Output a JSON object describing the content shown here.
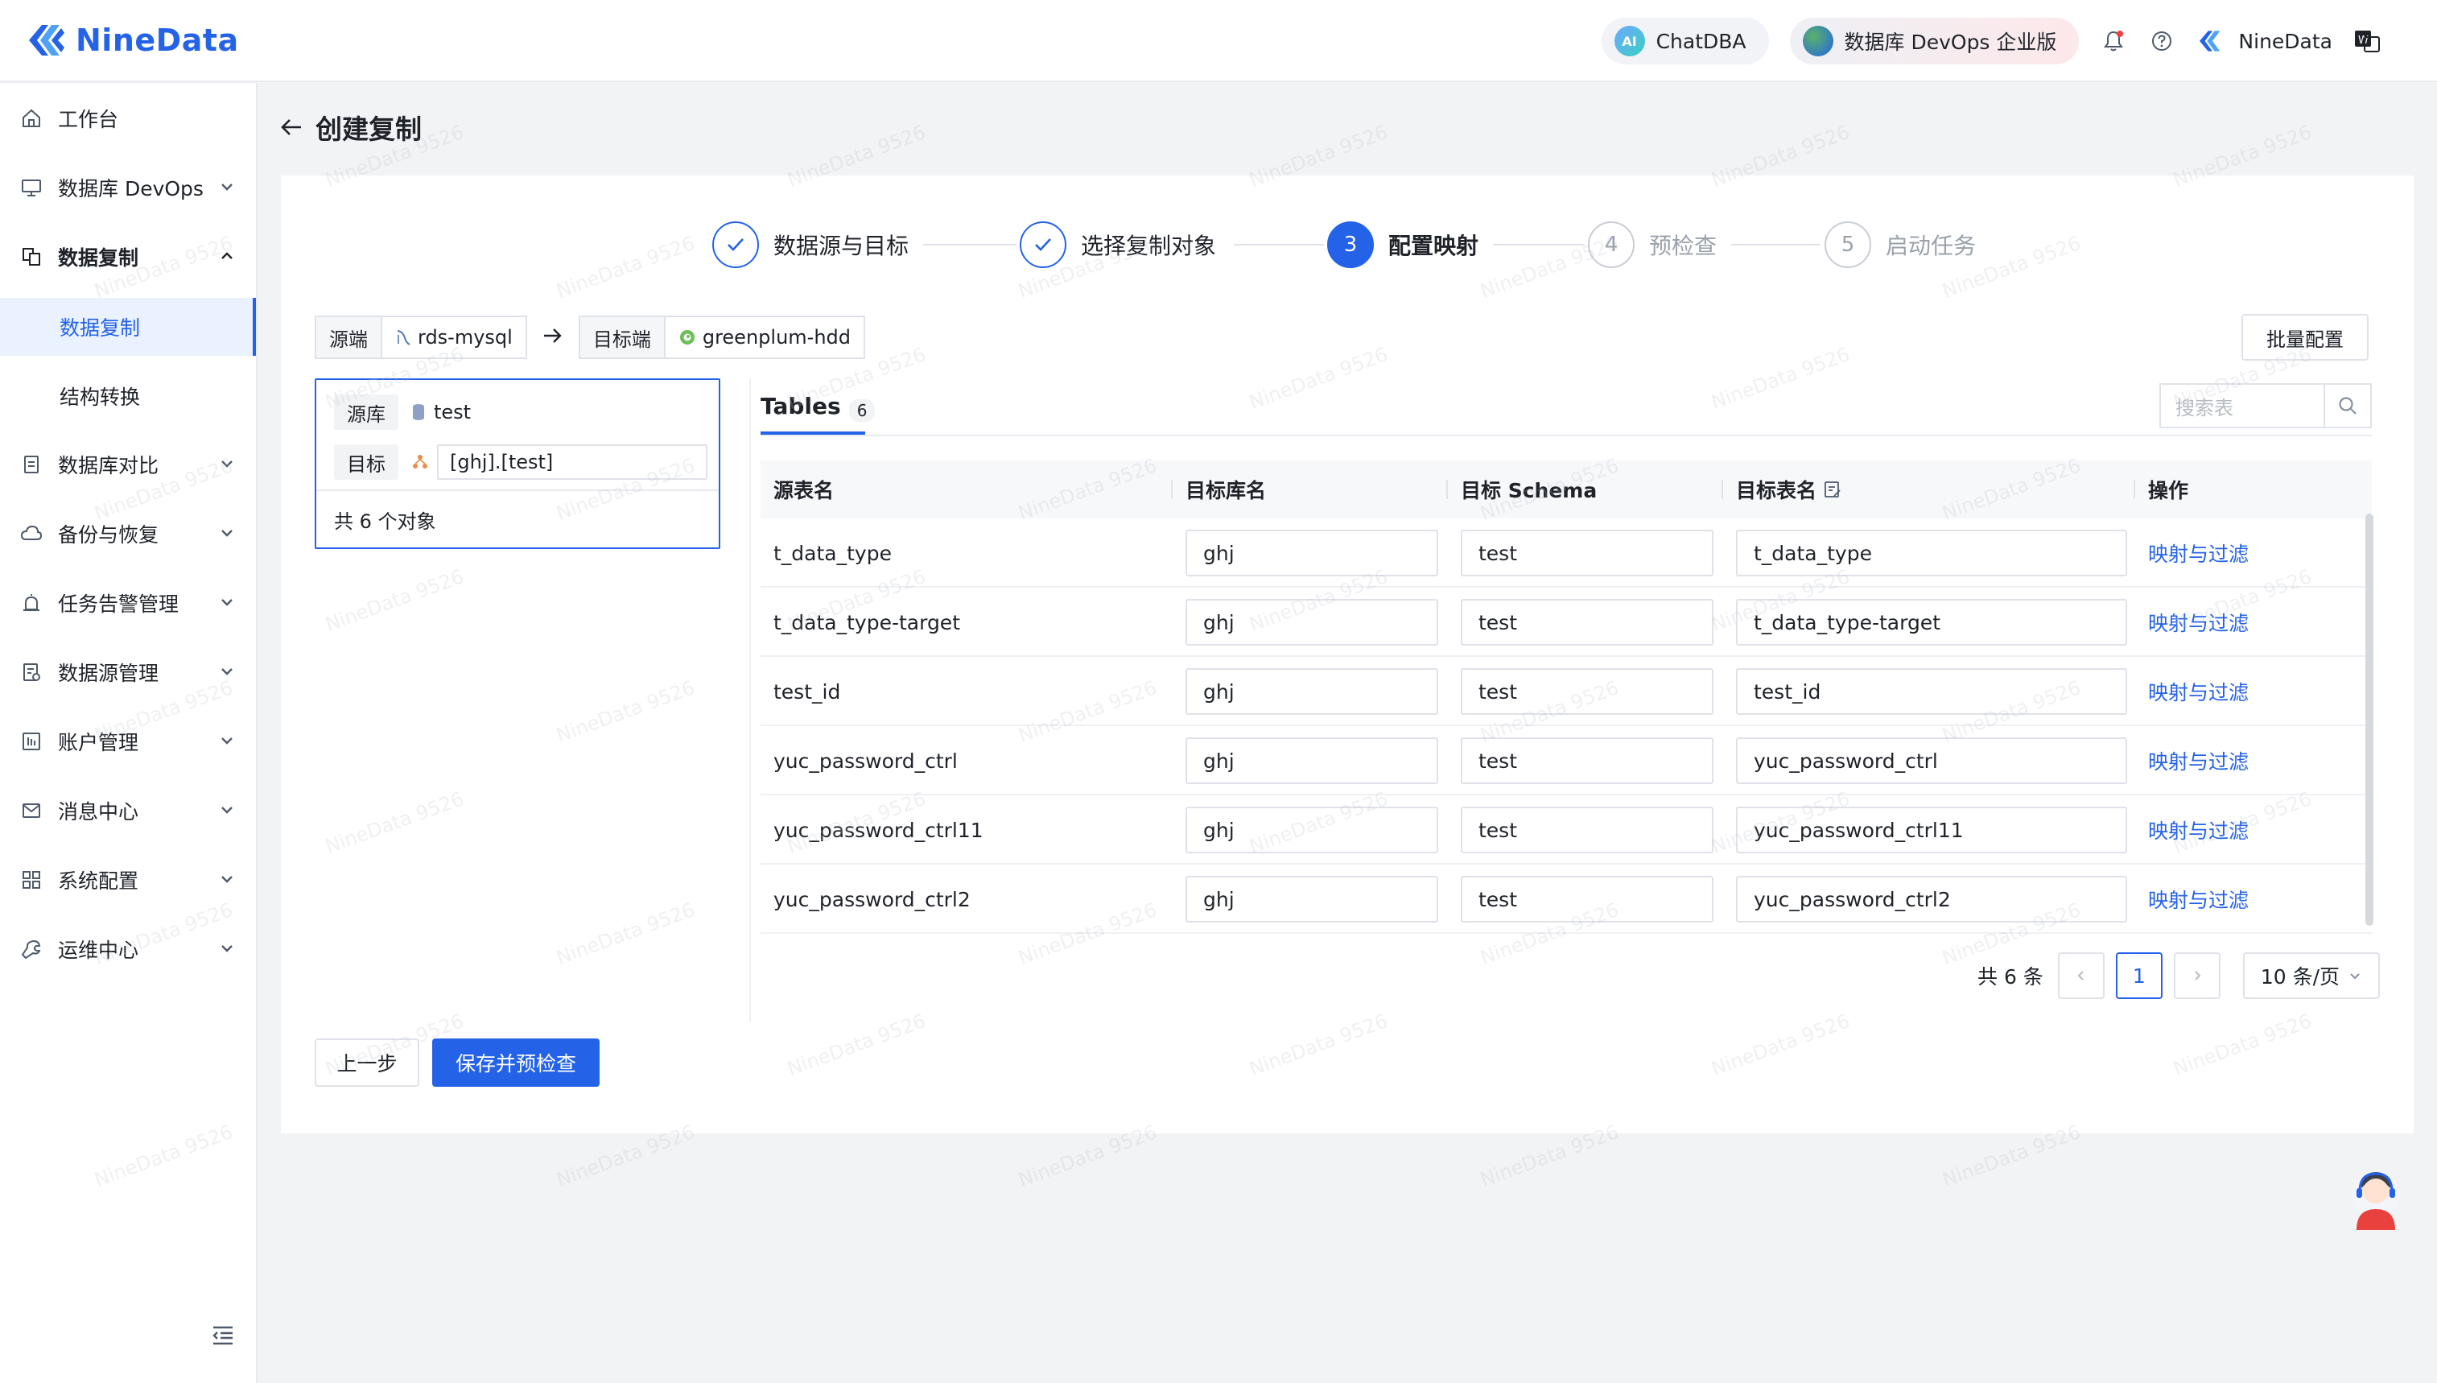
{
  "header": {
    "brand": "NineData",
    "chatdba_label": "ChatDBA",
    "chatdba_badge": "AI",
    "enterprise_label": "数据库 DevOps 企业版",
    "user_name": "NineData"
  },
  "sidebar": {
    "items": [
      {
        "label": "工作台",
        "icon": "home-icon"
      },
      {
        "label": "数据库 DevOps",
        "icon": "monitor-icon"
      },
      {
        "label": "数据复制",
        "icon": "replication-icon"
      },
      {
        "label": "数据复制"
      },
      {
        "label": "结构转换"
      },
      {
        "label": "数据库对比",
        "icon": "compare-icon"
      },
      {
        "label": "备份与恢复",
        "icon": "cloud-icon"
      },
      {
        "label": "任务告警管理",
        "icon": "alarm-icon"
      },
      {
        "label": "数据源管理",
        "icon": "datasource-icon"
      },
      {
        "label": "账户管理",
        "icon": "account-icon"
      },
      {
        "label": "消息中心",
        "icon": "mail-icon"
      },
      {
        "label": "系统配置",
        "icon": "grid-icon"
      },
      {
        "label": "运维中心",
        "icon": "wrench-icon"
      }
    ]
  },
  "page": {
    "title": "创建复制"
  },
  "steps": [
    {
      "num": "1",
      "label": "数据源与目标",
      "state": "done"
    },
    {
      "num": "2",
      "label": "选择复制对象",
      "state": "done"
    },
    {
      "num": "3",
      "label": "配置映射",
      "state": "active"
    },
    {
      "num": "4",
      "label": "预检查",
      "state": "pending"
    },
    {
      "num": "5",
      "label": "启动任务",
      "state": "pending"
    }
  ],
  "route": {
    "source_key": "源端",
    "source_val": "rds-mysql",
    "target_key": "目标端",
    "target_val": "greenplum-hdd"
  },
  "batch_button": "批量配置",
  "left_panel": {
    "src_tag": "源库",
    "src_val": "test",
    "tgt_tag": "目标",
    "tgt_val": "[ghj].[test]",
    "count": "共 6 个对象"
  },
  "tabs": {
    "label": "Tables",
    "count": "6"
  },
  "search": {
    "placeholder": "搜索表"
  },
  "table": {
    "headers": [
      "源表名",
      "目标库名",
      "目标 Schema",
      "目标表名",
      "操作"
    ],
    "rows": [
      {
        "src": "t_data_type",
        "db": "ghj",
        "schema": "test",
        "tbl": "t_data_type",
        "action": "映射与过滤"
      },
      {
        "src": "t_data_type-target",
        "db": "ghj",
        "schema": "test",
        "tbl": "t_data_type-target",
        "action": "映射与过滤"
      },
      {
        "src": "test_id",
        "db": "ghj",
        "schema": "test",
        "tbl": "test_id",
        "action": "映射与过滤"
      },
      {
        "src": "yuc_password_ctrl",
        "db": "ghj",
        "schema": "test",
        "tbl": "yuc_password_ctrl",
        "action": "映射与过滤"
      },
      {
        "src": "yuc_password_ctrl11",
        "db": "ghj",
        "schema": "test",
        "tbl": "yuc_password_ctrl11",
        "action": "映射与过滤"
      },
      {
        "src": "yuc_password_ctrl2",
        "db": "ghj",
        "schema": "test",
        "tbl": "yuc_password_ctrl2",
        "action": "映射与过滤"
      }
    ]
  },
  "pager": {
    "total": "共 6 条",
    "current": "1",
    "size": "10 条/页"
  },
  "footer": {
    "prev": "上一步",
    "save": "保存并预检查"
  },
  "watermark": "NineData 9526",
  "colors": {
    "accent": "#2462e8",
    "border": "#dfe2e8"
  }
}
